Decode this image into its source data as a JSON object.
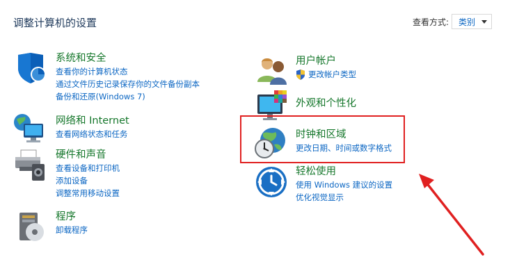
{
  "page": {
    "title": "调整计算机的设置"
  },
  "view_by": {
    "label": "查看方式:",
    "selected": "类别"
  },
  "categories": {
    "system_security": {
      "title": "系统和安全",
      "links": [
        "查看你的计算机状态",
        "通过文件历史记录保存你的文件备份副本",
        "备份和还原(Windows 7)"
      ]
    },
    "network": {
      "title": "网络和 Internet",
      "links": [
        "查看网络状态和任务"
      ]
    },
    "hardware": {
      "title": "硬件和声音",
      "links": [
        "查看设备和打印机",
        "添加设备",
        "调整常用移动设置"
      ]
    },
    "programs": {
      "title": "程序",
      "links": [
        "卸载程序"
      ]
    },
    "user_accounts": {
      "title": "用户帐户",
      "links": [
        "更改帐户类型"
      ]
    },
    "appearance": {
      "title": "外观和个性化",
      "links": []
    },
    "clock_region": {
      "title": "时钟和区域",
      "links": [
        "更改日期、时间或数字格式"
      ]
    },
    "ease_access": {
      "title": "轻松使用",
      "links": [
        "使用 Windows 建议的设置",
        "优化视觉显示"
      ]
    }
  },
  "colors": {
    "title_green": "#15772b",
    "link_blue": "#0b66c3",
    "annotation_red": "#e02020"
  }
}
